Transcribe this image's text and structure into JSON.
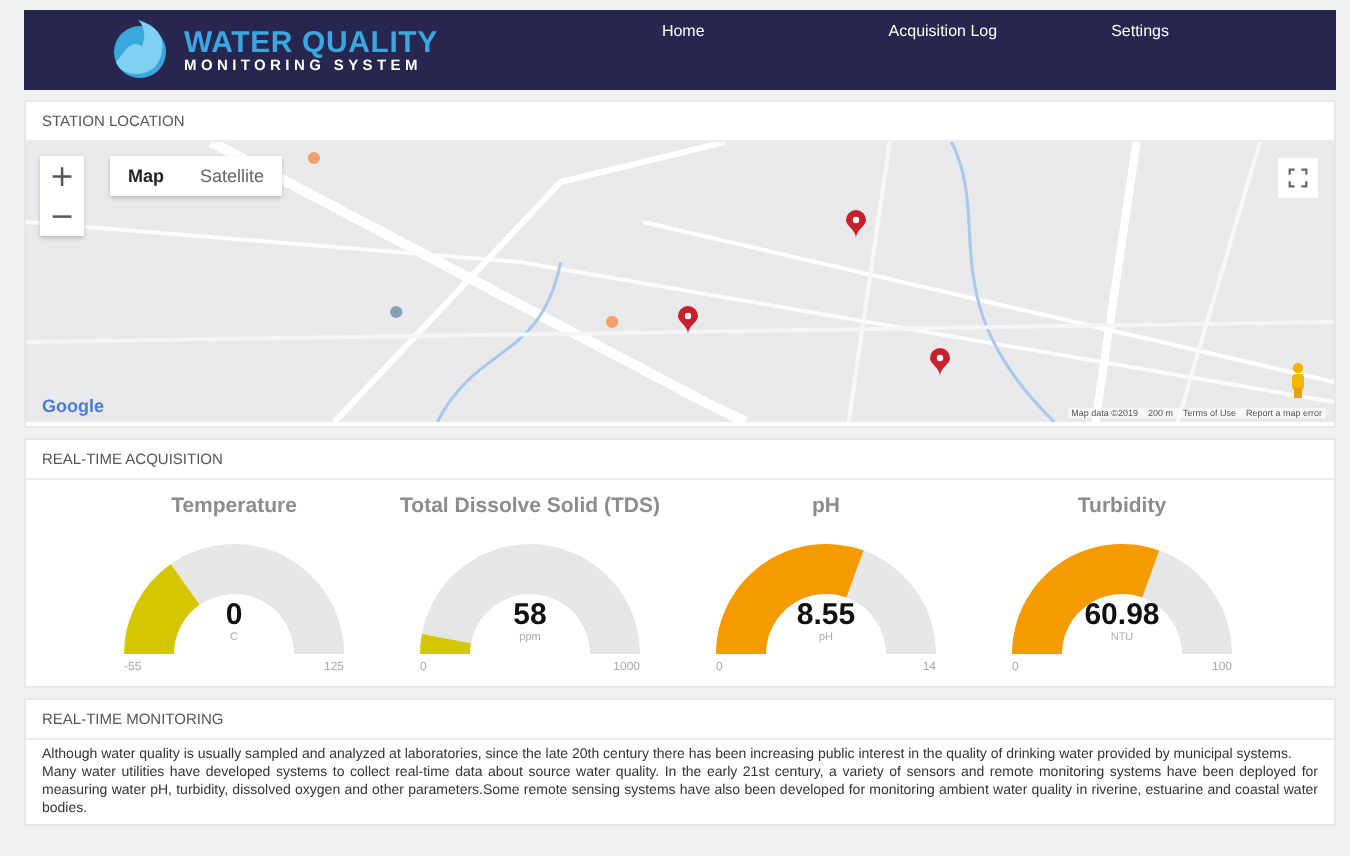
{
  "header": {
    "logo": {
      "title": "WATER QUALITY",
      "subtitle": "MONITORING SYSTEM"
    },
    "nav": [
      {
        "label": "Home"
      },
      {
        "label": "Acquisition Log"
      },
      {
        "label": "Settings"
      }
    ]
  },
  "station_location": {
    "title": "STATION LOCATION",
    "map": {
      "map_types": [
        {
          "label": "Map",
          "selected": true
        },
        {
          "label": "Satellite",
          "selected": false
        }
      ],
      "zoom_in": "+",
      "zoom_out": "−",
      "google": "Google",
      "attribution": [
        "Map data ©2019",
        "200 m",
        "Terms of Use",
        "Report a map error"
      ]
    }
  },
  "acquisition": {
    "title": "REAL-TIME ACQUISITION",
    "gauges": [
      {
        "title": "Temperature",
        "value": "0",
        "unit": "C",
        "min": "-55",
        "max": "125",
        "color": "#d4c600"
      },
      {
        "title": "Total Dissolve Solid (TDS)",
        "value": "58",
        "unit": "ppm",
        "min": "0",
        "max": "1000",
        "color": "#d4c600"
      },
      {
        "title": "pH",
        "value": "8.55",
        "unit": "pH",
        "min": "0",
        "max": "14",
        "color": "#f59b00"
      },
      {
        "title": "Turbidity",
        "value": "60.98",
        "unit": "NTU",
        "min": "0",
        "max": "100",
        "color": "#f59b00"
      }
    ]
  },
  "monitoring": {
    "title": "REAL-TIME MONITORING",
    "paragraphs": [
      "Although water quality is usually sampled and analyzed at laboratories, since the late 20th century there has been increasing public interest in the quality of drinking water provided by municipal systems.",
      "Many water utilities have developed systems to collect real-time data about source water quality. In the early 21st century, a variety of sensors and remote monitoring systems have been deployed for measuring water pH, turbidity, dissolved oxygen and other parameters.Some remote sensing systems have also been developed for monitoring ambient water quality in riverine, estuarine and coastal water bodies."
    ]
  }
}
